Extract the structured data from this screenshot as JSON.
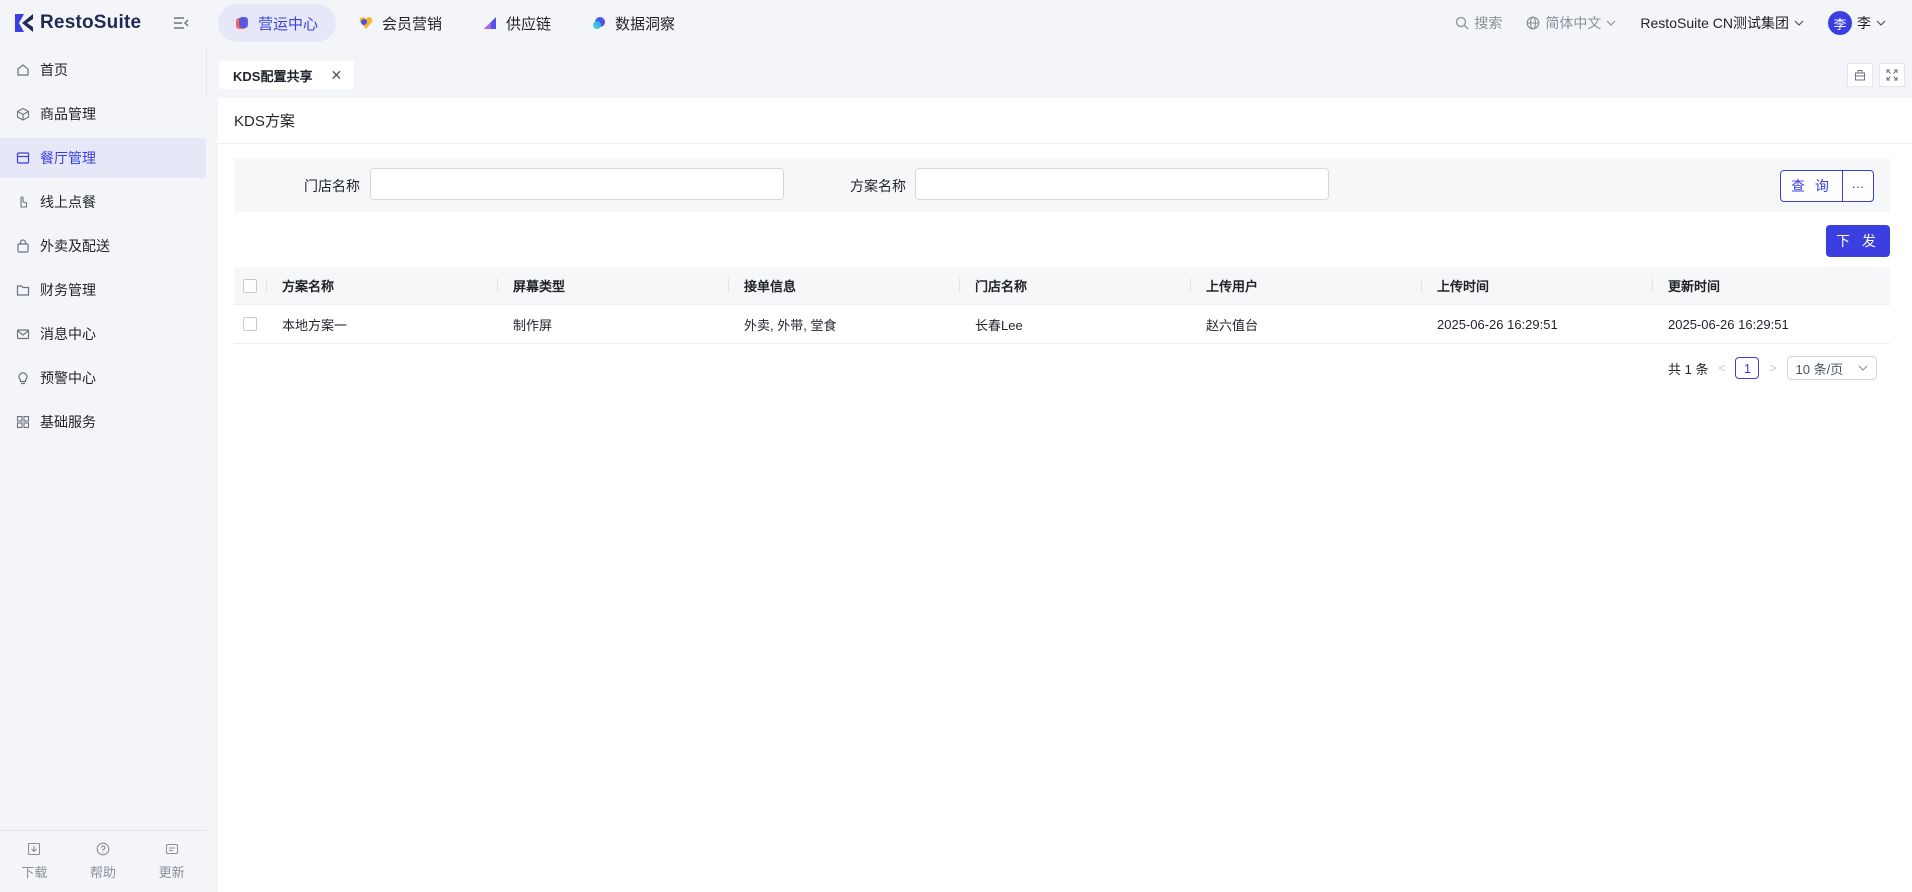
{
  "brand": {
    "name": "RestoSuite",
    "accent": "#3b3fe0"
  },
  "top_nav": {
    "tabs": [
      {
        "label": "营运中心",
        "active": true
      },
      {
        "label": "会员营销",
        "active": false
      },
      {
        "label": "供应链",
        "active": false
      },
      {
        "label": "数据洞察",
        "active": false
      }
    ],
    "search_label": "搜索",
    "language_label": "简体中文",
    "org_label": "RestoSuite CN测试集团",
    "avatar_initial": "李",
    "user_name": "李"
  },
  "sidebar": {
    "items": [
      {
        "label": "首页",
        "icon": "home-icon"
      },
      {
        "label": "商品管理",
        "icon": "box-icon"
      },
      {
        "label": "餐厅管理",
        "icon": "store-icon",
        "active": true
      },
      {
        "label": "线上点餐",
        "icon": "hand-pointer-icon"
      },
      {
        "label": "外卖及配送",
        "icon": "bag-icon"
      },
      {
        "label": "财务管理",
        "icon": "folder-icon"
      },
      {
        "label": "消息中心",
        "icon": "mail-icon"
      },
      {
        "label": "预警中心",
        "icon": "bulb-icon"
      },
      {
        "label": "基础服务",
        "icon": "grid-icon"
      }
    ],
    "footer": {
      "download": "下载",
      "help": "帮助",
      "update": "更新"
    }
  },
  "page_tab": {
    "label": "KDS配置共享"
  },
  "panel": {
    "title": "KDS方案",
    "filters": {
      "store_label": "门店名称",
      "store_value": "",
      "plan_label": "方案名称",
      "plan_value": ""
    },
    "query_button": "查 询",
    "more_button": "···",
    "publish_button": "下 发",
    "table": {
      "headers": [
        "方案名称",
        "屏幕类型",
        "接单信息",
        "门店名称",
        "上传用户",
        "上传时间",
        "更新时间"
      ],
      "rows": [
        [
          "本地方案一",
          "制作屏",
          "外卖, 外带, 堂食",
          "长春Lee",
          "赵六值台",
          "2025-06-26 16:29:51",
          "2025-06-26 16:29:51"
        ]
      ]
    },
    "pagination": {
      "total_label": "共 1 条",
      "current_page": "1",
      "page_size_label": "10 条/页"
    }
  }
}
